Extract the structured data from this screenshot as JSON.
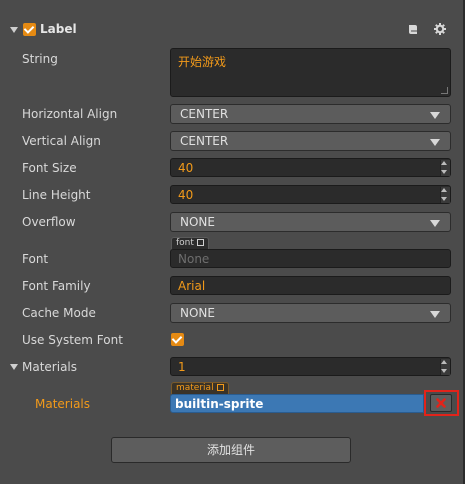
{
  "component": {
    "title": "Label",
    "enabled": true,
    "icons": {
      "docs": "book-icon",
      "settings": "gear-icon"
    }
  },
  "props": {
    "string": {
      "label": "String",
      "value": "开始游戏"
    },
    "horizontal_align": {
      "label": "Horizontal Align",
      "value": "CENTER"
    },
    "vertical_align": {
      "label": "Vertical Align",
      "value": "CENTER"
    },
    "font_size": {
      "label": "Font Size",
      "value": "40"
    },
    "line_height": {
      "label": "Line Height",
      "value": "40"
    },
    "overflow": {
      "label": "Overflow",
      "value": "NONE"
    },
    "font": {
      "label": "Font",
      "tag": "font",
      "value": "None"
    },
    "font_family": {
      "label": "Font Family",
      "value": "Arial"
    },
    "cache_mode": {
      "label": "Cache Mode",
      "value": "NONE"
    },
    "use_system_font": {
      "label": "Use System Font",
      "checked": true
    },
    "materials": {
      "label": "Materials",
      "count": "1"
    },
    "material_item": {
      "label": "Materials",
      "tag": "material",
      "value": "builtin-sprite"
    }
  },
  "add_component_label": "添加组件",
  "colors": {
    "accent": "#f29a1a",
    "selected": "#3c78b4",
    "highlight_box": "#e2231a"
  }
}
